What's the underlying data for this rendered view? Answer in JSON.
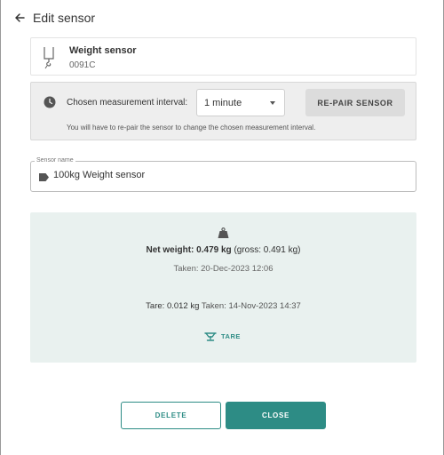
{
  "header": {
    "title": "Edit sensor"
  },
  "sensor": {
    "name": "Weight sensor",
    "id": "0091C"
  },
  "interval": {
    "label": "Chosen measurement interval:",
    "selected": "1 minute",
    "repair_label": "RE-PAIR SENSOR",
    "hint": "You will have to re-pair the sensor to change the chosen measurement interval."
  },
  "name_field": {
    "label": "Sensor name",
    "value": "100kg Weight sensor"
  },
  "weight": {
    "net_label": "Net weight:",
    "net_value": "0.479 kg",
    "gross_text": "(gross: 0.491 kg)",
    "taken": "Taken: 20-Dec-2023 12:06",
    "tare_label": "Tare:",
    "tare_value": "0.012 kg",
    "tare_taken": "Taken: 14-Nov-2023 14:37",
    "tare_button": "TARE"
  },
  "actions": {
    "delete_label": "DELETE",
    "close_label": "CLOSE"
  },
  "colors": {
    "accent": "#2d8c85",
    "panel_bg": "#e9f1ef",
    "interval_bg": "#eeeeee"
  },
  "icons": {
    "back": "arrow-left-icon",
    "sensor": "hanging-scale-icon",
    "clock": "clock-icon",
    "tag": "tag-icon",
    "weight": "weight-icon",
    "tare": "scale-tare-icon",
    "caret": "chevron-down-icon"
  }
}
